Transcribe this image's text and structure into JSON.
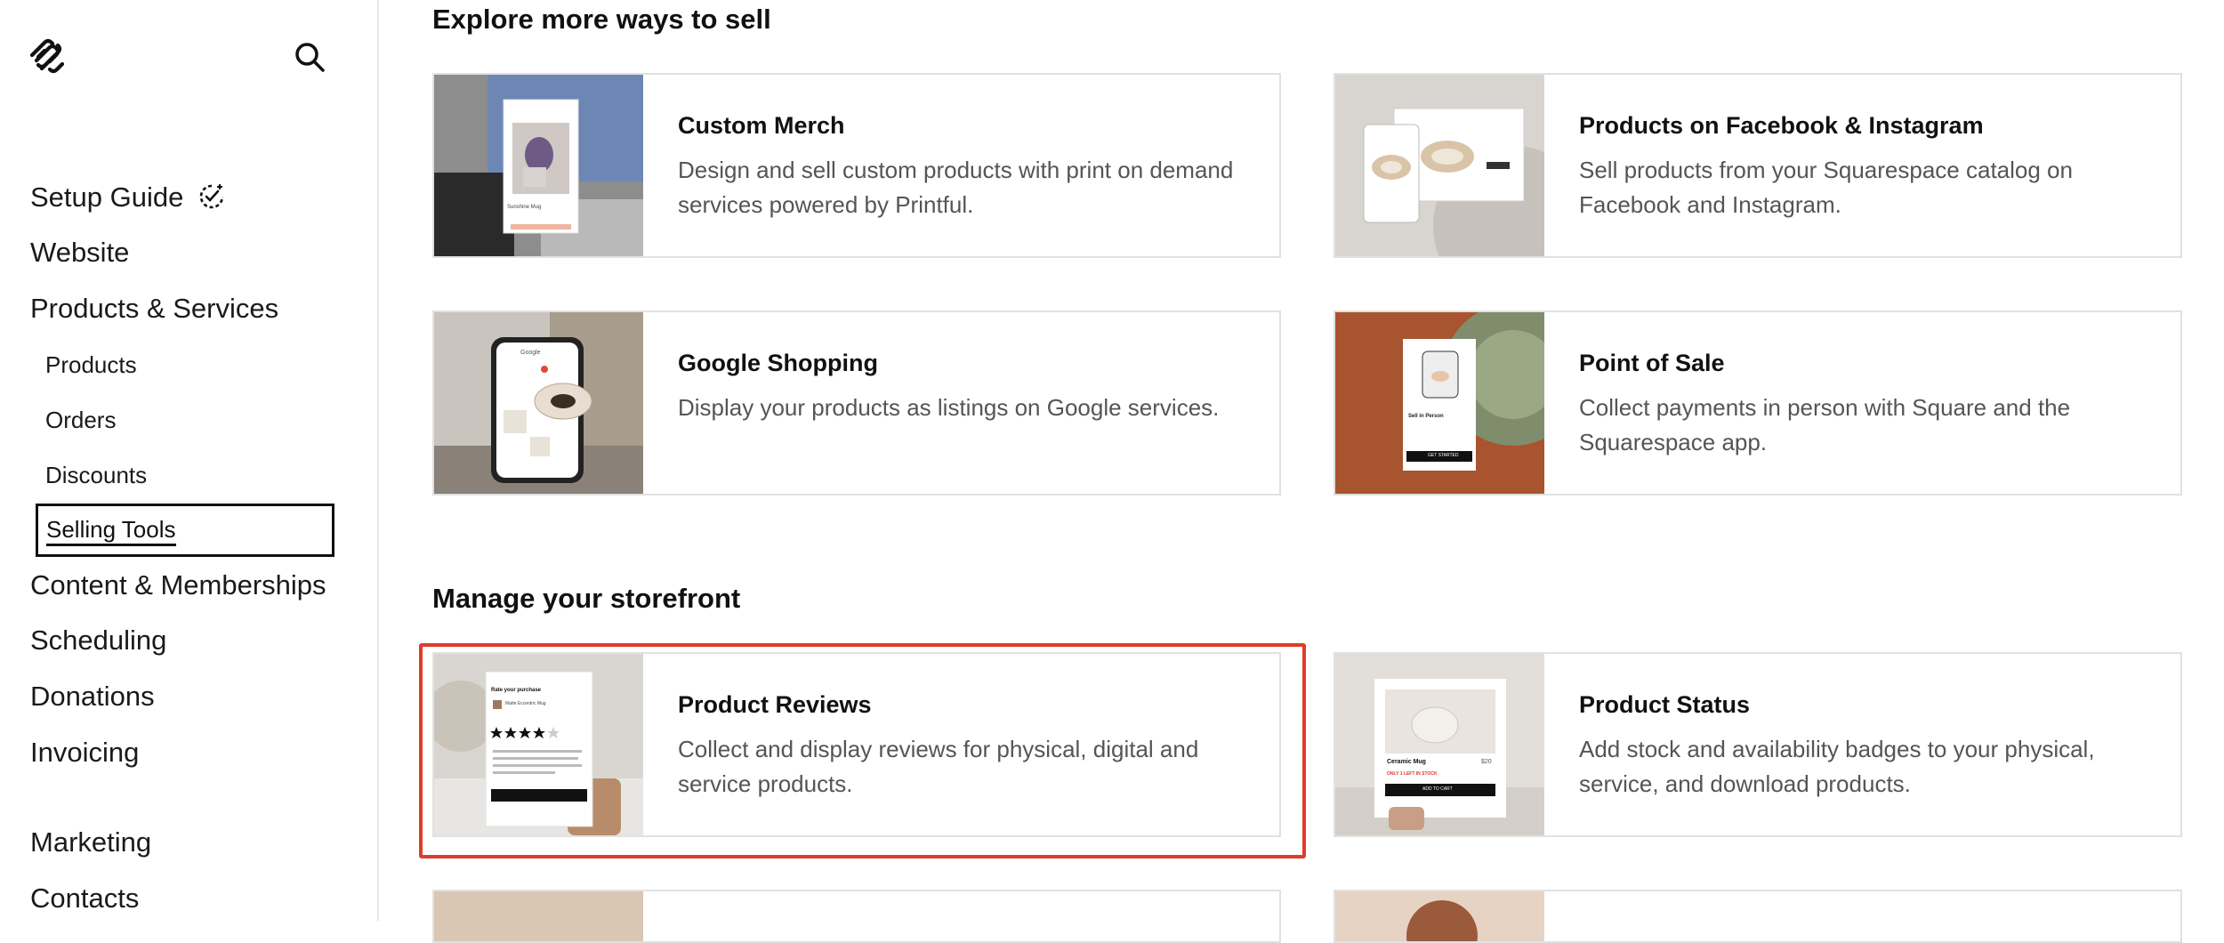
{
  "sidebar": {
    "nav": [
      {
        "label": "Setup Guide"
      },
      {
        "label": "Website"
      },
      {
        "label": "Products & Services"
      },
      {
        "label": "Content & Memberships"
      },
      {
        "label": "Scheduling"
      },
      {
        "label": "Donations"
      },
      {
        "label": "Invoicing"
      },
      {
        "label": "Marketing"
      },
      {
        "label": "Contacts"
      }
    ],
    "sub": [
      {
        "label": "Products"
      },
      {
        "label": "Orders"
      },
      {
        "label": "Discounts"
      },
      {
        "label": "Selling Tools",
        "selected": true
      }
    ]
  },
  "sections": [
    {
      "title": "Explore more ways to sell",
      "cards": [
        {
          "title": "Custom Merch",
          "desc": "Design and sell custom products with print on demand services powered by Printful.",
          "thumb_text": "Sunshine Mug"
        },
        {
          "title": "Products on Facebook & Instagram",
          "desc": "Sell products from your Squarespace catalog on Facebook and Instagram."
        },
        {
          "title": "Google Shopping",
          "desc": "Display your products as listings on Google services.",
          "thumb_text": "Google"
        },
        {
          "title": "Point of Sale",
          "desc": "Collect payments in person with Square and the Squarespace app.",
          "thumb_text": "Sell in Person",
          "thumb_button": "GET STARTED"
        }
      ]
    },
    {
      "title": "Manage your storefront",
      "cards": [
        {
          "title": "Product Reviews",
          "desc": "Collect and display reviews for physical, digital and service products.",
          "thumb_text": "Rate your purchase",
          "thumb_item": "Matte Eccentric Mug",
          "highlighted": true
        },
        {
          "title": "Product Status",
          "desc": "Add stock and availability badges to your physical, service, and download products.",
          "thumb_text": "Ceramic Mug",
          "thumb_price": "$20",
          "thumb_badge": "ONLY 1 LEFT IN STOCK",
          "thumb_button": "ADD TO CART"
        }
      ]
    }
  ],
  "colors": {
    "highlight": "#e13b29",
    "text": "#111111",
    "muted": "#555555",
    "border": "#e1e1e1"
  }
}
